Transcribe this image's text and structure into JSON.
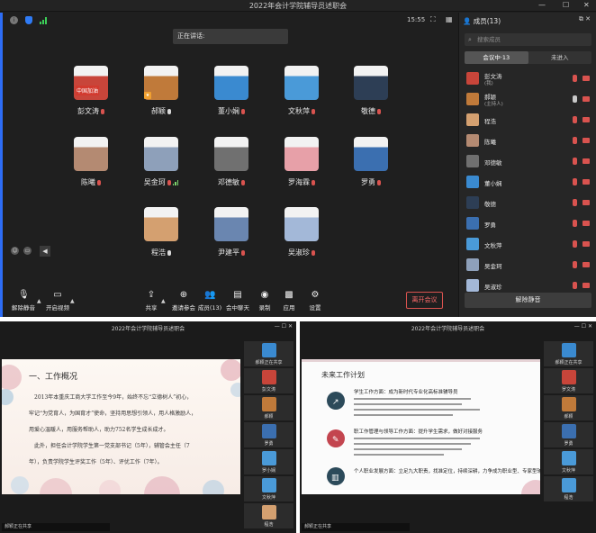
{
  "meeting": {
    "title": "2022年会计学院辅导员述职会",
    "time": "15:55",
    "speaking_label": "正在讲话:",
    "participants": [
      {
        "name": "彭文涛",
        "sign": "中国加油",
        "color": "#c8453a"
      },
      {
        "name": "郝颖",
        "color": "#c07a3a"
      },
      {
        "name": "董小娴",
        "color": "#3a8ad0"
      },
      {
        "name": "文秋萍",
        "color": "#4a9ad8"
      },
      {
        "name": "敬德",
        "color": "#2d3e55"
      },
      {
        "name": "陈曦",
        "color": "#b48a72"
      },
      {
        "name": "吴金珂",
        "color": "#8ea0ba"
      },
      {
        "name": "邓德敏",
        "color": "#707070"
      },
      {
        "name": "罗海霖",
        "color": "#e7a0a8"
      },
      {
        "name": "罗勇",
        "color": "#3b6fb0"
      },
      {
        "name": "程浩",
        "color": "#d4a070"
      },
      {
        "name": "尹建平",
        "color": "#6a86b0"
      },
      {
        "name": "吴淑珍",
        "color": "#a3b8d8"
      }
    ],
    "toolbar": {
      "mute": "解除静音",
      "video": "开启视频",
      "share": "共享",
      "invite": "邀请参会",
      "members": "成员(13)",
      "chat": "会中聊天",
      "record": "录制",
      "apps": "应用",
      "settings": "设置",
      "leave": "离开会议"
    },
    "panel": {
      "title": "成员(13)",
      "search_placeholder": "搜索成员",
      "tab_in": "会议中·13",
      "tab_out": "未进入",
      "unmute_all": "解除静音",
      "members": [
        {
          "name": "彭文涛",
          "sub": "(我)",
          "color": "#c8453a"
        },
        {
          "name": "郝颖",
          "sub": "(主持人)",
          "color": "#c07a3a"
        },
        {
          "name": "程浩",
          "sub": "",
          "color": "#d4a070"
        },
        {
          "name": "陈曦",
          "sub": "",
          "color": "#b48a72"
        },
        {
          "name": "邓德敏",
          "sub": "",
          "color": "#707070"
        },
        {
          "name": "董小娴",
          "sub": "",
          "color": "#3a8ad0"
        },
        {
          "name": "敬德",
          "sub": "",
          "color": "#2d3e55"
        },
        {
          "name": "罗勇",
          "sub": "",
          "color": "#3b6fb0"
        },
        {
          "name": "文秋萍",
          "sub": "",
          "color": "#4a9ad8"
        },
        {
          "name": "吴金珂",
          "sub": "",
          "color": "#8ea0ba"
        },
        {
          "name": "吴淑珍",
          "sub": "",
          "color": "#a3b8d8"
        }
      ]
    }
  },
  "left_window": {
    "title": "2022年会计学院辅导员述职会",
    "slide_heading": "一、工作概况",
    "slide_lines": [
      "2013年本重庆工商大学工作至今9年，始终不忘“立德树人”初心，",
      "牢记“为党育人，为国育才”使命，坚持用思想引领人，用人格激励人，",
      "用爱心温暖人，用服务帮助人，助力752名学生成长成才。",
      "此外，担任会计学院学生第一党支部书记（5年），辅管会主任（7",
      "年），负责学院学生评奖工作（5年）、评优工作（7年）。"
    ],
    "thumbs": [
      "郝颖正在共享",
      "彭文涛",
      "郝颖",
      "罗勇",
      "罗小娴",
      "文秋萍",
      "程浩"
    ],
    "status": "郝颖正在共享"
  },
  "right_window": {
    "title": "2022年会计学院辅导员述职会",
    "slide_heading": "未来工作计划",
    "items": [
      {
        "title": "学生工作方面：成为新时代专业化高标准辅导员"
      },
      {
        "title": "职工作管理与领导工作方面：提升学生需求，做好对接服务"
      },
      {
        "title": "个人职业发展方面：立足九大职责，找准定位，持续深耕，力争成为职业型、专家型辅导员"
      }
    ],
    "thumbs": [
      "郝颖正在共享",
      "罗文涛",
      "郝颖",
      "罗勇",
      "文秋萍",
      "程浩"
    ],
    "status": "郝颖正在共享"
  }
}
